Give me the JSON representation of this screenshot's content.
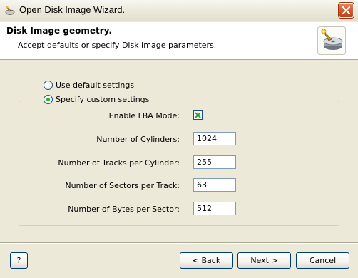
{
  "window": {
    "title": "Open Disk Image Wizard."
  },
  "header": {
    "title": "Disk Image geometry.",
    "subtitle": "Accept defaults or specify Disk Image parameters."
  },
  "options": {
    "default_label": "Use default settings",
    "custom_label": "Specify custom settings",
    "selected": "custom"
  },
  "form": {
    "lba_label": "Enable LBA Mode:",
    "lba_checked": true,
    "cylinders_label": "Number of Cylinders:",
    "cylinders_value": "1024",
    "tracks_label": "Number of Tracks per Cylinder:",
    "tracks_value": "255",
    "sectors_label": "Number of Sectors per Track:",
    "sectors_value": "63",
    "bytes_label": "Number of Bytes per Sector:",
    "bytes_value": "512"
  },
  "buttons": {
    "help": "?",
    "back_mnemonic": "B",
    "back_rest": "ack",
    "back_prefix": "< ",
    "next_mnemonic": "N",
    "next_rest": "ext >",
    "cancel_mnemonic": "C",
    "cancel_rest": "ancel"
  },
  "colors": {
    "accent": "#003c74",
    "check": "#2ab02a",
    "close": "#d35a2f"
  }
}
